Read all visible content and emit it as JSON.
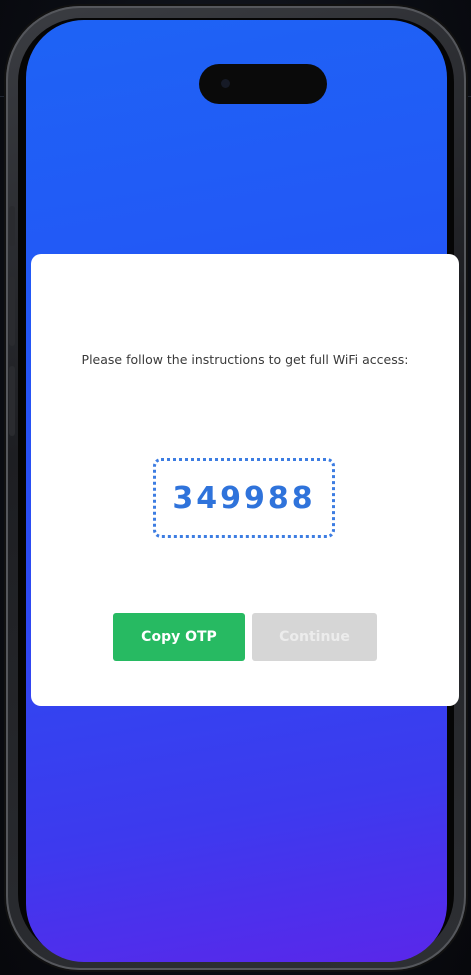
{
  "screen": {
    "instructions": "Please follow the instructions to get full WiFi access:",
    "otp_code": "349988",
    "buttons": {
      "copy_label": "Copy OTP",
      "continue_label": "Continue",
      "continue_enabled": false
    }
  },
  "colors": {
    "screen_gradient_top": "#1e63f5",
    "screen_gradient_bottom": "#5a27ea",
    "otp_text": "#2f73db",
    "otp_border": "#3d7de2",
    "copy_button": "#27ba62",
    "continue_button_disabled": "#d6d6d6"
  },
  "icons": [
    "dynamic-island",
    "front-camera"
  ]
}
